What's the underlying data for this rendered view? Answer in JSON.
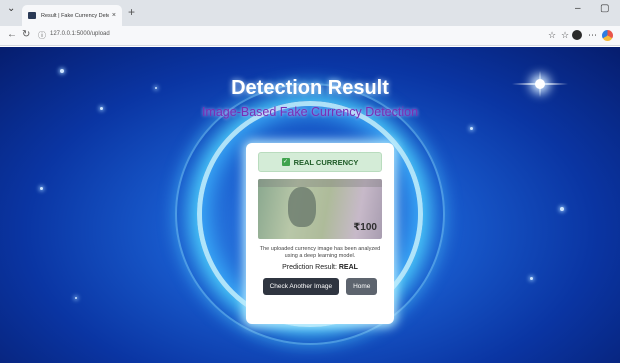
{
  "browser": {
    "tab_title": "Result | Fake Currency Detection",
    "tab_close": "×",
    "new_tab": "+",
    "url": "127.0.0.1:5000/upload",
    "minimize": "–",
    "restore": "▢"
  },
  "page": {
    "title": "Detection Result",
    "subtitle": "Image-Based Fake Currency Detection"
  },
  "card": {
    "badge_text": "REAL CURRENCY",
    "note_denomination": "₹100",
    "description": "The uploaded currency image has been analyzed using a deep learning model.",
    "prediction_label": "Prediction Result:",
    "prediction_value": "REAL",
    "check_again_label": "Check Another Image",
    "home_label": "Home"
  },
  "colors": {
    "badge_bg": "#d4ecd7",
    "badge_text": "#1f5c28",
    "button_dark": "#2f3540",
    "subtitle": "#7a2fb5"
  }
}
